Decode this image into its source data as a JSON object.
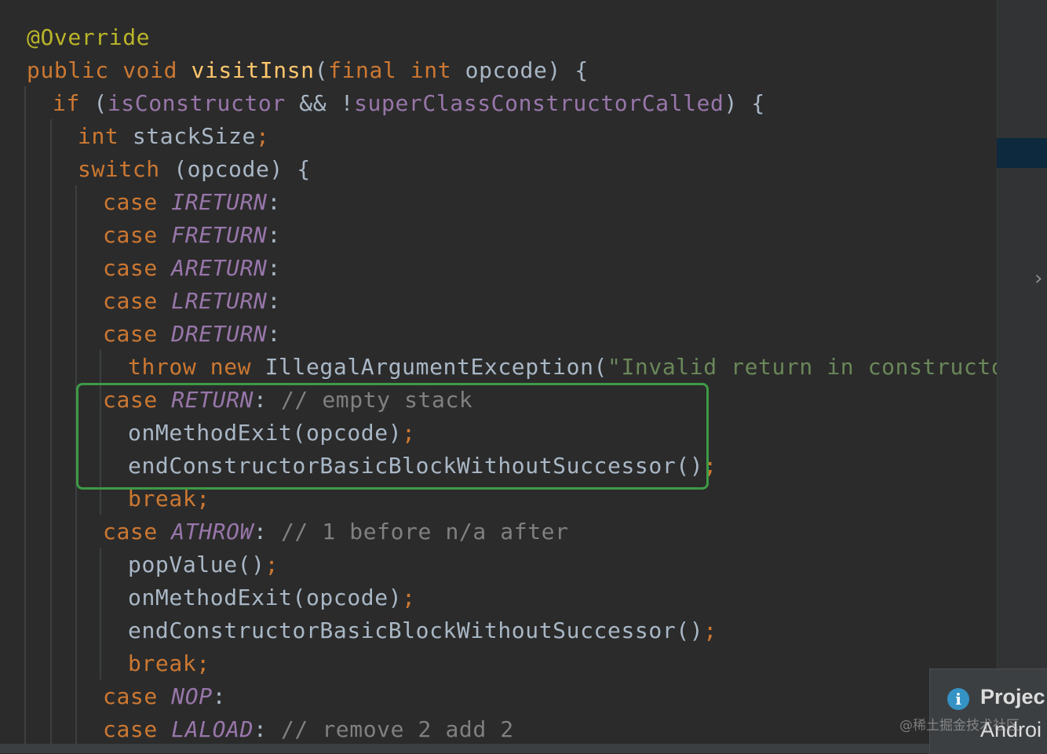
{
  "code": {
    "lines": [
      [
        [
          "ann",
          "@Override"
        ]
      ],
      [
        [
          "kw",
          "public void "
        ],
        [
          "fn",
          "visitInsn"
        ],
        [
          "plain",
          "("
        ],
        [
          "kw",
          "final int "
        ],
        [
          "plain",
          "opcode) {"
        ]
      ],
      [
        [
          "kw",
          "if "
        ],
        [
          "plain",
          "("
        ],
        [
          "field",
          "isConstructor "
        ],
        [
          "plain",
          "&& !"
        ],
        [
          "field",
          "superClassConstructorCalled"
        ],
        [
          "plain",
          ") {"
        ]
      ],
      [
        [
          "kw",
          "int "
        ],
        [
          "plain",
          "stackSize"
        ],
        [
          "semi",
          ";"
        ]
      ],
      [
        [
          "kw",
          "switch "
        ],
        [
          "plain",
          "(opcode) {"
        ]
      ],
      [
        [
          "kw",
          "case "
        ],
        [
          "const",
          "IRETURN"
        ],
        [
          "plain",
          ":"
        ]
      ],
      [
        [
          "kw",
          "case "
        ],
        [
          "const",
          "FRETURN"
        ],
        [
          "plain",
          ":"
        ]
      ],
      [
        [
          "kw",
          "case "
        ],
        [
          "const",
          "ARETURN"
        ],
        [
          "plain",
          ":"
        ]
      ],
      [
        [
          "kw",
          "case "
        ],
        [
          "const",
          "LRETURN"
        ],
        [
          "plain",
          ":"
        ]
      ],
      [
        [
          "kw",
          "case "
        ],
        [
          "const",
          "DRETURN"
        ],
        [
          "plain",
          ":"
        ]
      ],
      [
        [
          "kw",
          "throw new "
        ],
        [
          "plain",
          "IllegalArgumentException("
        ],
        [
          "str",
          "\"Invalid return in constructor\""
        ],
        [
          "plain",
          ")"
        ],
        [
          "semi",
          ";"
        ]
      ],
      [
        [
          "kw",
          "case "
        ],
        [
          "const",
          "RETURN"
        ],
        [
          "plain",
          ": "
        ],
        [
          "cmt",
          "// empty stack"
        ]
      ],
      [
        [
          "plain",
          "onMethodExit(opcode)"
        ],
        [
          "semi",
          ";"
        ]
      ],
      [
        [
          "plain",
          "endConstructorBasicBlockWithoutSuccessor()"
        ],
        [
          "semi",
          ";"
        ]
      ],
      [
        [
          "kw",
          "break;"
        ]
      ],
      [
        [
          "kw",
          "case "
        ],
        [
          "const",
          "ATHROW"
        ],
        [
          "plain",
          ": "
        ],
        [
          "cmt",
          "// 1 before n/a after"
        ]
      ],
      [
        [
          "plain",
          "popValue()"
        ],
        [
          "semi",
          ";"
        ]
      ],
      [
        [
          "plain",
          "onMethodExit(opcode)"
        ],
        [
          "semi",
          ";"
        ]
      ],
      [
        [
          "plain",
          "endConstructorBasicBlockWithoutSuccessor()"
        ],
        [
          "semi",
          ";"
        ]
      ],
      [
        [
          "kw",
          "break;"
        ]
      ],
      [
        [
          "kw",
          "case "
        ],
        [
          "const",
          "NOP"
        ],
        [
          "plain",
          ":"
        ]
      ],
      [
        [
          "kw",
          "case "
        ],
        [
          "const",
          "LALOAD"
        ],
        [
          "plain",
          ": "
        ],
        [
          "cmt",
          "// remove 2 add 2"
        ]
      ]
    ]
  },
  "notification": {
    "icon": "info-icon",
    "title": "Projec",
    "body": "Androi"
  },
  "watermark": "@稀土掘金技术社区",
  "colors": {
    "background": "#2b2b2b",
    "keyword": "#cc7832",
    "annotation": "#bbb529",
    "function": "#ffc66d",
    "field": "#9876aa",
    "string": "#6a8759",
    "comment": "#808080",
    "text": "#a9b7c6",
    "highlight_box": "#3e9a45"
  }
}
